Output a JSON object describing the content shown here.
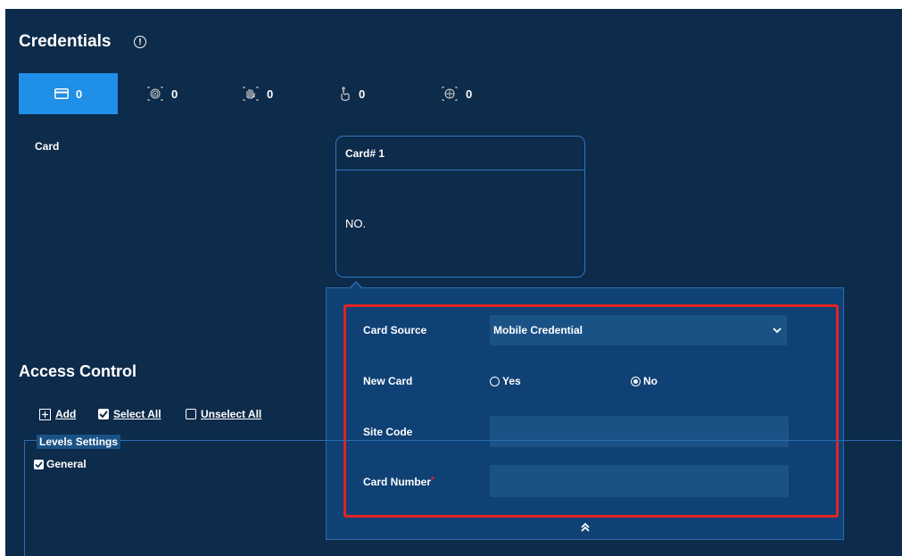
{
  "credentials": {
    "title": "Credentials",
    "info_icon": "info-circle-icon",
    "tabs": [
      {
        "icon": "card-icon",
        "count": "0",
        "active": true
      },
      {
        "icon": "fingerprint-icon",
        "count": "0",
        "active": false
      },
      {
        "icon": "palm-icon",
        "count": "0",
        "active": false
      },
      {
        "icon": "finger-vein-icon",
        "count": "0",
        "active": false
      },
      {
        "icon": "face-icon",
        "count": "0",
        "active": false
      }
    ],
    "card_label": "Card",
    "card_box": {
      "header": "Card# 1",
      "value": "NO."
    }
  },
  "card_form": {
    "card_source_label": "Card Source",
    "card_source_value": "Mobile Credential",
    "new_card_label": "New Card",
    "new_card_options": [
      {
        "label": "Yes",
        "selected": false
      },
      {
        "label": "No",
        "selected": true
      }
    ],
    "site_code_label": "Site Code",
    "site_code_value": "",
    "card_number_label": "Card Number",
    "card_number_required": "*",
    "card_number_value": "",
    "collapse_icon": "double-chevron-up-icon"
  },
  "access_control": {
    "title": "Access Control",
    "toolbar": {
      "add_label": "Add",
      "select_all_label": "Select All",
      "unselect_all_label": "Unselect All"
    },
    "levels_settings_label": "Levels Settings",
    "levels": [
      {
        "label": "General",
        "checked": true
      }
    ]
  },
  "colors": {
    "panel_bg": "#0d2b4a",
    "active_tab": "#1f8fe8",
    "popup_bg": "#0f4175",
    "highlight_frame": "#e02424"
  }
}
